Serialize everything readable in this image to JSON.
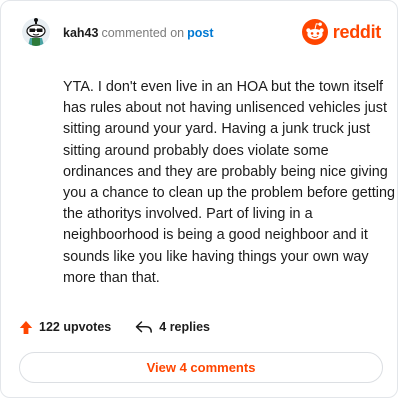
{
  "header": {
    "username": "kah43",
    "commented_on": "commented on",
    "post_link": "post",
    "brand": "reddit",
    "brand_color": "#ff4500",
    "avatar_icon": "snoo-avatar-icon"
  },
  "comment": {
    "text": "YTA. I don't even live in an HOA but the town itself has rules about not having unlisenced vehicles just sitting around your yard. Having a junk truck just sitting around probably does violate some ordinances and they are probably being nice giving you a chance to clean up the problem before getting the athoritys involved. Part of living in a neighboorhood is being a good neighboor and it sounds like you like having things your own way more than that."
  },
  "actions": {
    "upvotes": "122 upvotes",
    "upvote_icon": "upvote-arrow-icon",
    "replies": "4 replies",
    "reply_icon": "reply-arrow-icon"
  },
  "footer": {
    "view_comments": "View 4 comments"
  }
}
